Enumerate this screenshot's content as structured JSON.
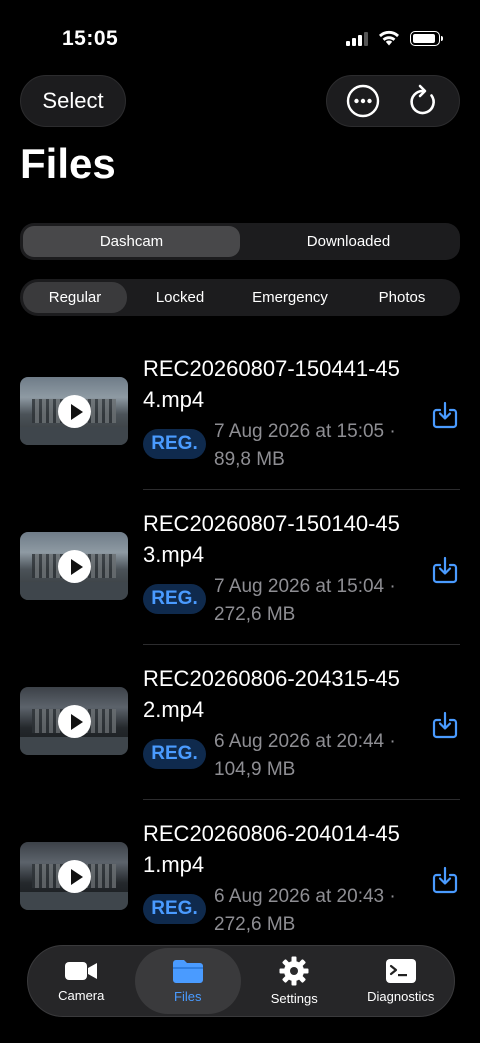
{
  "status": {
    "time": "15:05"
  },
  "header": {
    "select_label": "Select",
    "actions": [
      "more-icon",
      "refresh-icon"
    ],
    "title": "Files"
  },
  "source_tabs": [
    {
      "label": "Dashcam",
      "active": true
    },
    {
      "label": "Downloaded",
      "active": false
    }
  ],
  "filter_tabs": [
    {
      "label": "Regular",
      "active": true
    },
    {
      "label": "Locked",
      "active": false
    },
    {
      "label": "Emergency",
      "active": false
    },
    {
      "label": "Photos",
      "active": false
    }
  ],
  "files": [
    {
      "name": "REC20260807-150441-454.mp4",
      "badge": "REG.",
      "meta": "7 Aug 2026 at 15:05 · 89,8 MB"
    },
    {
      "name": "REC20260807-150140-453.mp4",
      "badge": "REG.",
      "meta": "7 Aug 2026 at 15:04 · 272,6 MB"
    },
    {
      "name": "REC20260806-204315-452.mp4",
      "badge": "REG.",
      "meta": "6 Aug 2026 at 20:44 · 104,9 MB"
    },
    {
      "name": "REC20260806-204014-451.mp4",
      "badge": "REG.",
      "meta": "6 Aug 2026 at 20:43 · 272,6 MB"
    }
  ],
  "tab_bar": [
    {
      "label": "Camera",
      "icon": "camera-icon",
      "active": false
    },
    {
      "label": "Files",
      "icon": "folder-icon",
      "active": true
    },
    {
      "label": "Settings",
      "icon": "gear-icon",
      "active": false
    },
    {
      "label": "Diagnostics",
      "icon": "terminal-icon",
      "active": false
    }
  ],
  "colors": {
    "accent": "#4a9bff",
    "badge_bg": "#0f2a4d",
    "background": "#000000"
  }
}
